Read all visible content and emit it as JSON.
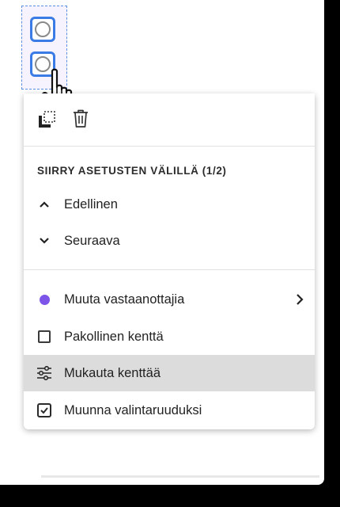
{
  "menu": {
    "toolbar": {
      "duplicate_icon": "duplicate-icon",
      "delete_icon": "trash-icon"
    },
    "section_heading": "SIIRRY ASETUSTEN VÄLILLÄ (1/2)",
    "nav": {
      "previous": "Edellinen",
      "next": "Seuraava"
    },
    "items": [
      {
        "label": "Muuta vastaanottajia",
        "icon": "recipient-dot",
        "color": "#7d54e8",
        "has_submenu": true
      },
      {
        "label": "Pakollinen kenttä",
        "icon": "checkbox-unchecked-icon"
      },
      {
        "label": "Mukauta kenttää",
        "icon": "sliders-icon",
        "highlighted": true
      },
      {
        "label": "Muunna valintaruuduksi",
        "icon": "checkbox-checked-icon"
      }
    ]
  },
  "colors": {
    "selection_border": "#5b8fdf",
    "field_border": "#3b7be6",
    "highlight": "#dcdcdc"
  }
}
